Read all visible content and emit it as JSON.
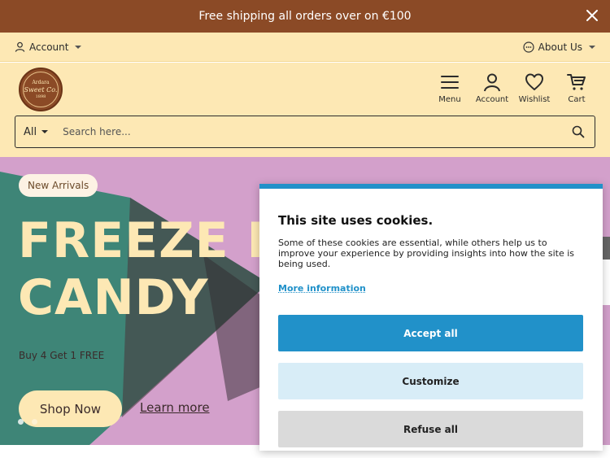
{
  "announcement": {
    "text": "Free shipping all orders over on €100"
  },
  "utility": {
    "account_label": "Account",
    "about_label": "About Us"
  },
  "logo": {
    "line1": "Ardara",
    "line2": "Sweet Co.",
    "line3": "1898"
  },
  "nav": {
    "menu_label": "Menu",
    "account_label": "Account",
    "wishlist_label": "Wishlist",
    "cart_label": "Cart"
  },
  "search": {
    "category": "All",
    "placeholder": "Search here..."
  },
  "hero": {
    "badge": "New Arrivals",
    "headline_line1": "FREEZE DRIED",
    "headline_line2": "CANDY",
    "promo": "Buy 4 Get 1 FREE",
    "shop_label": "Shop Now",
    "learn_label": "Learn more",
    "slide_count": 2,
    "active_slide": 1
  },
  "cookie": {
    "title": "This site uses cookies.",
    "body": "Some of these cookies are essential, while others help us to improve your experience by providing insights into how the site is being used.",
    "more_label": "More information",
    "accept_label": "Accept all",
    "customize_label": "Customize",
    "refuse_label": "Refuse all"
  },
  "colors": {
    "brand_brown": "#8b4a26",
    "cream": "#fde8b4",
    "hero_pink": "#d3a0cb",
    "hero_teal": "#3e8577",
    "cookie_accent": "#2191c9"
  },
  "icons": [
    "close-icon",
    "user-icon",
    "chat-icon",
    "menu-icon",
    "heart-icon",
    "cart-icon",
    "search-icon"
  ]
}
